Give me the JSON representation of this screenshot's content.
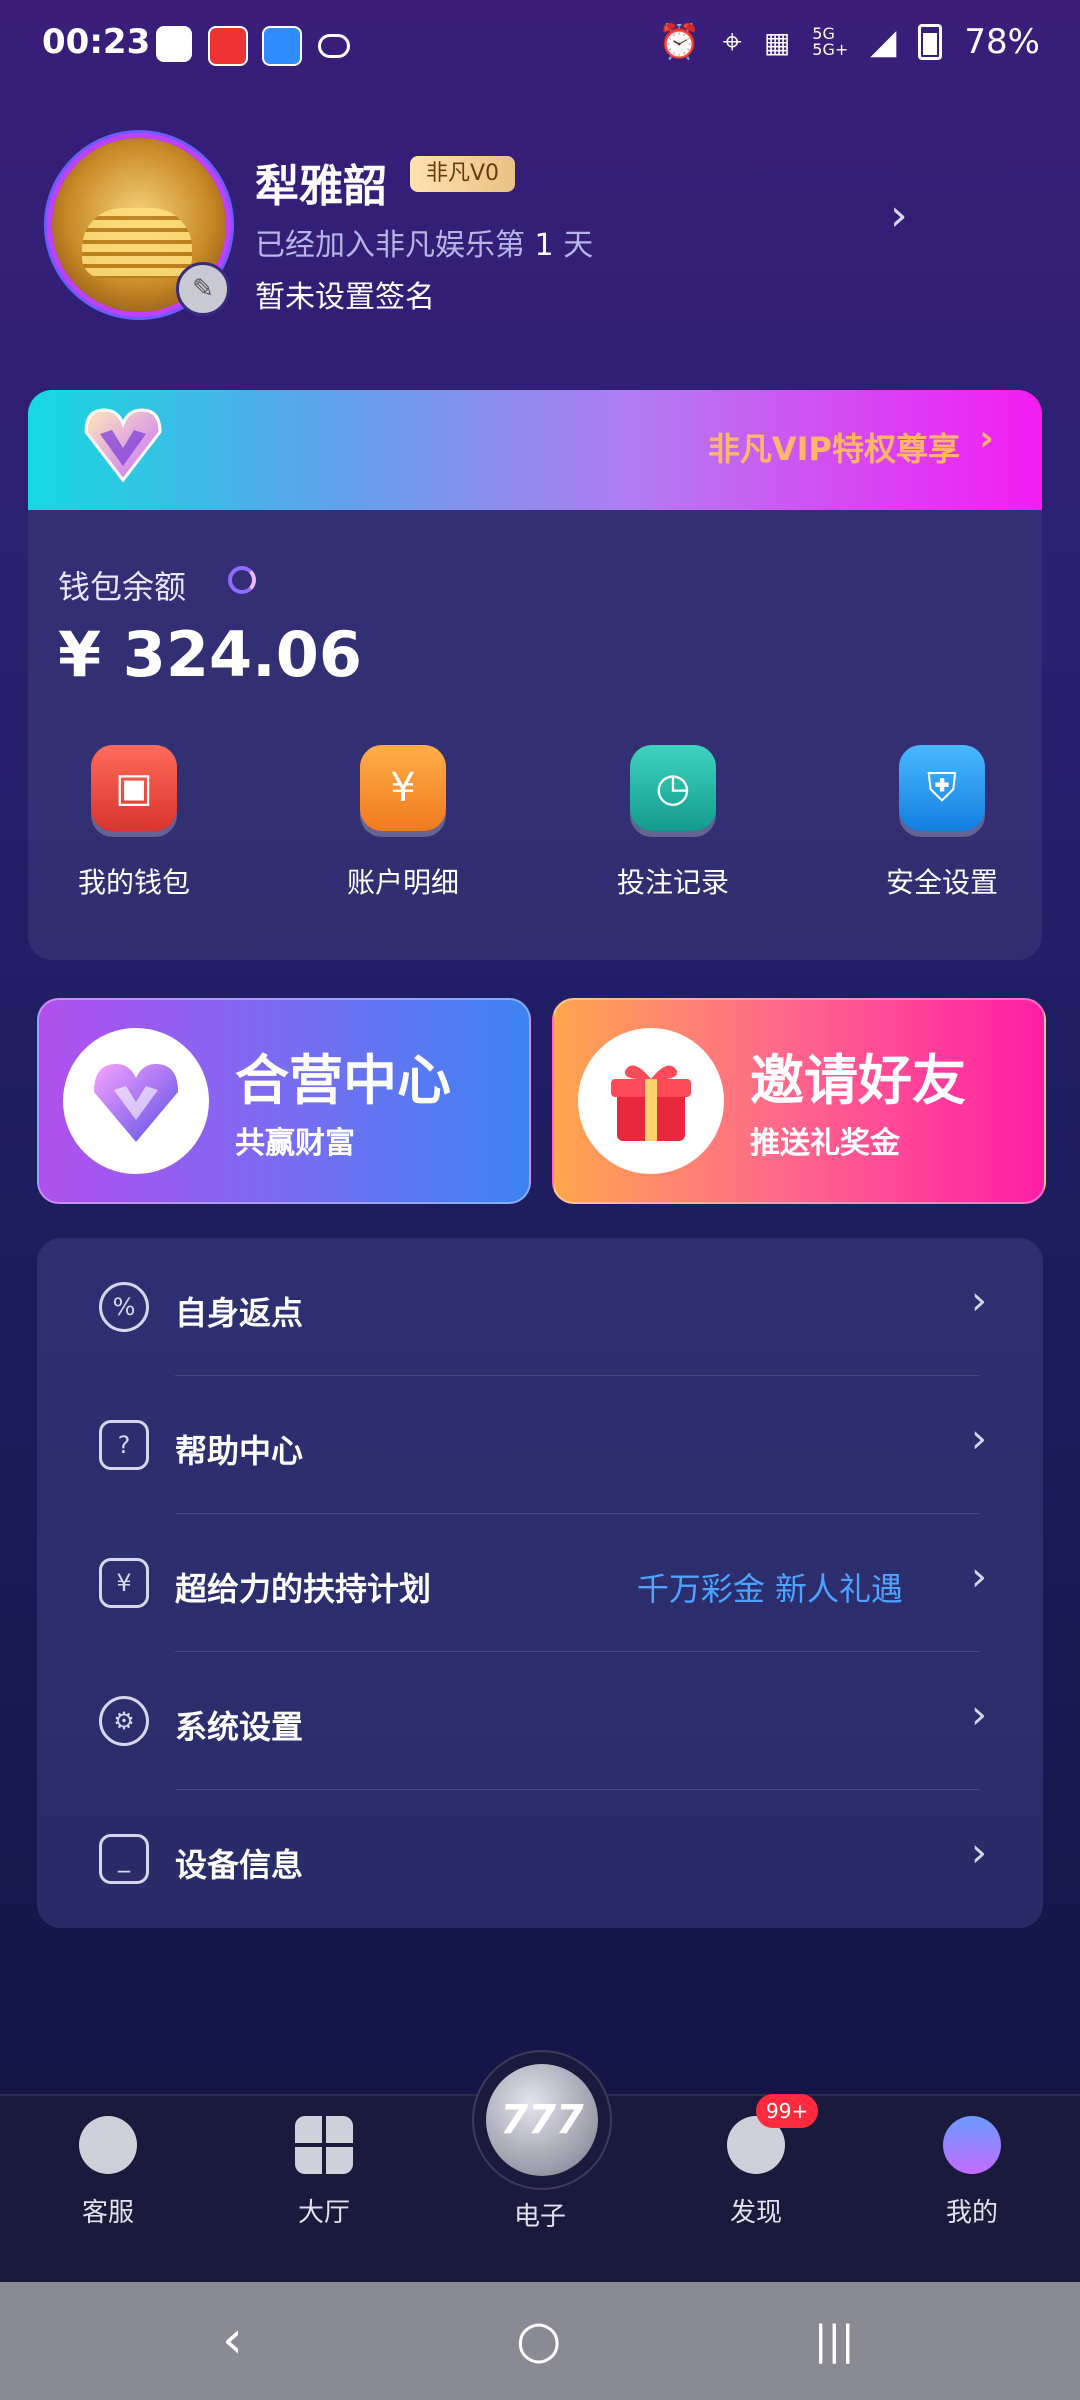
{
  "status_bar": {
    "time": "00:23",
    "network": "5G",
    "network2": "5G+",
    "battery": "78%",
    "icons": [
      "message-icon",
      "news-app-icon",
      "browser-app-icon",
      "cloud-icon",
      "alarm-icon",
      "location-icon",
      "nfc-icon",
      "signal-icon",
      "battery-icon"
    ]
  },
  "profile": {
    "name": "犁雅韶",
    "vip_badge": "非凡V0",
    "joined_prefix": "已经加入非凡娱乐第",
    "joined_days": "1",
    "joined_suffix": "天",
    "signature": "暂未设置签名"
  },
  "vip_banner": {
    "text": "非凡VIP特权尊享",
    "arrow": "›"
  },
  "wallet": {
    "label": "钱包余额",
    "balance": "¥ 324.06",
    "actions": [
      {
        "label": "我的钱包",
        "icon": "wallet-icon",
        "color": "#e8493f"
      },
      {
        "label": "账户明细",
        "icon": "bill-icon",
        "color": "#f6892e"
      },
      {
        "label": "投注记录",
        "icon": "record-icon",
        "color": "#1fb8a6"
      },
      {
        "label": "安全设置",
        "icon": "shield-icon",
        "color": "#1e9cf0"
      }
    ]
  },
  "promos": [
    {
      "title": "合营中心",
      "subtitle": "共赢财富"
    },
    {
      "title": "邀请好友",
      "subtitle": "推送礼奖金"
    }
  ],
  "menu": [
    {
      "label": "自身返点",
      "extra": "",
      "icon": "rebate-icon"
    },
    {
      "label": "帮助中心",
      "extra": "",
      "icon": "help-icon"
    },
    {
      "label": "超给力的扶持计划",
      "extra": "千万彩金 新人礼遇",
      "icon": "gift-icon"
    },
    {
      "label": "系统设置",
      "extra": "",
      "icon": "settings-icon"
    },
    {
      "label": "设备信息",
      "extra": "",
      "icon": "device-icon"
    }
  ],
  "bottom_nav": [
    {
      "label": "客服",
      "icon": "chat-icon"
    },
    {
      "label": "大厅",
      "icon": "grid-icon"
    },
    {
      "label": "电子",
      "icon": "slot-777-icon"
    },
    {
      "label": "发现",
      "icon": "discover-icon",
      "badge": "99+"
    },
    {
      "label": "我的",
      "icon": "profile-icon"
    }
  ],
  "center_button": "777",
  "system_nav": {
    "back": "‹",
    "home": "○",
    "recents": "|||"
  }
}
